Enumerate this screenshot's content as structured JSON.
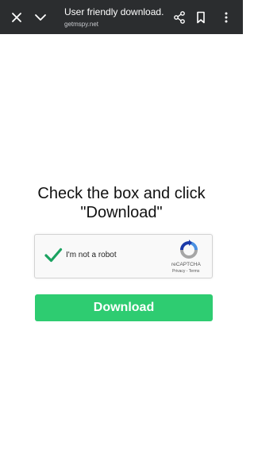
{
  "browser": {
    "title": "User friendly download...",
    "url": "getmspy.net",
    "icons": [
      "close-icon",
      "chevron-down-icon",
      "share-icon",
      "bookmark-icon",
      "more-vertical-icon"
    ],
    "bar_color": "#2b2d2f"
  },
  "page": {
    "heading_line1": "Check the box and click",
    "heading_line2": "\"Download\"",
    "captcha": {
      "label": "I'm not a robot",
      "brand": "reCAPTCHA",
      "privacy": "Privacy",
      "separator": " - ",
      "terms": "Terms",
      "checked": true
    },
    "download_label": "Download",
    "button_color": "#2ecc71",
    "check_color": "#1aa260"
  }
}
